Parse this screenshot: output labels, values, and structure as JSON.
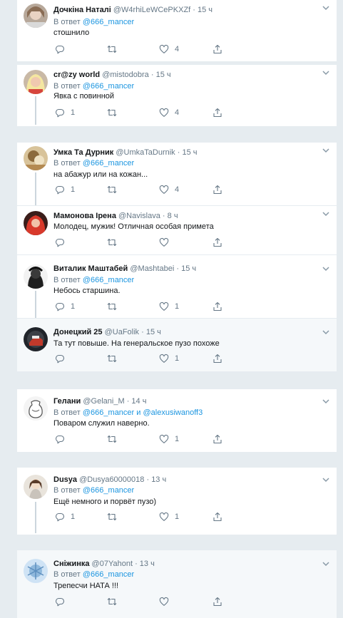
{
  "reply_prefix": "В ответ",
  "reply_and": "и",
  "tweets": [
    {
      "name": "Дочкіна Наталі",
      "handle": "@W4rhiLeWCePKXZf",
      "time": "15 ч",
      "reply_to": "@666_mancer",
      "text": "стошнило",
      "likes": "4"
    },
    {
      "name": "cr@zy world",
      "handle": "@mistodobra",
      "time": "15 ч",
      "reply_to": "@666_mancer",
      "text": "Явка с повинной",
      "replies": "1",
      "likes": "4"
    },
    {
      "name": "Умка Та Дурник",
      "handle": "@UmkaTaDurnik",
      "time": "15 ч",
      "reply_to": "@666_mancer",
      "text": "на абажур или на кожан...",
      "replies": "1",
      "likes": "4"
    },
    {
      "name": "Мамонова Ірена",
      "handle": "@Navislava",
      "time": "8 ч",
      "text": "Молодец, мужик! Отличная особая примета"
    },
    {
      "name": "Виталик Маштабей",
      "handle": "@Mashtabei",
      "time": "15 ч",
      "reply_to": "@666_mancer",
      "text": "Небось старшина.",
      "replies": "1",
      "likes": "1"
    },
    {
      "name": "Донецкий 25",
      "handle": "@UaFolik",
      "time": "15 ч",
      "text": "Та тут повыше. На генеральское пузо похоже",
      "likes": "1"
    },
    {
      "name": "Гелани",
      "handle": "@Gelani_M",
      "time": "14 ч",
      "reply_to": "@666_mancer",
      "reply_to_2": "@alexusiwanoff3",
      "text": "Поваром служил наверно.",
      "likes": "1"
    },
    {
      "name": "Dusya",
      "handle": "@Dusya60000018",
      "time": "13 ч",
      "reply_to": "@666_mancer",
      "text": "Ещё немного и порвёт пузо)",
      "replies": "1",
      "likes": "1"
    },
    {
      "name": "Сніжинка",
      "handle": "@07Yahont",
      "time": "13 ч",
      "reply_to": "@666_mancer",
      "text": "Трепесчи НАТА !!!"
    }
  ]
}
